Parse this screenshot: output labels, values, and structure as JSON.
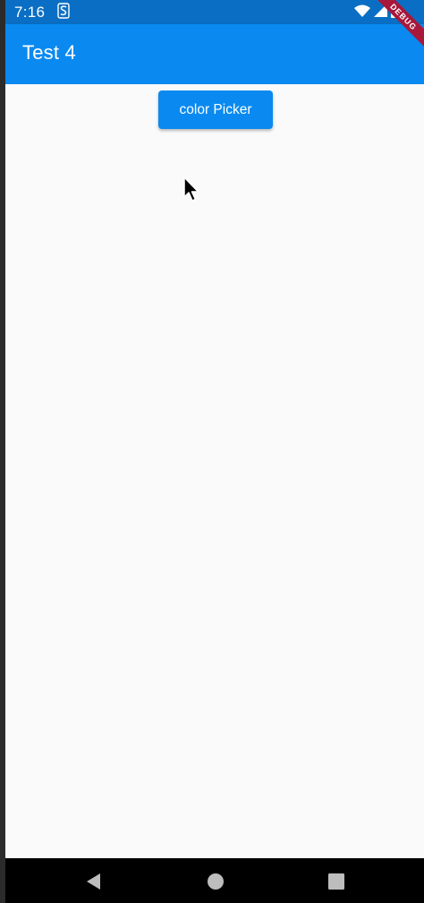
{
  "status_bar": {
    "time": "7:16",
    "icons": [
      "sync-s-icon",
      "wifi-icon",
      "signal-icon",
      "battery-icon"
    ]
  },
  "app_bar": {
    "title": "Test 4"
  },
  "debug_banner": {
    "label": "DEBUG"
  },
  "main": {
    "color_picker_button_label": "color Picker"
  },
  "nav_bar": {
    "buttons": [
      "back-icon",
      "home-icon",
      "recents-icon"
    ]
  },
  "colors": {
    "status_bar": "#0a6fc4",
    "app_bar": "#0a8af0",
    "background": "#fafafa",
    "button": "#0a8af0",
    "debug_banner": "#a8183b"
  }
}
